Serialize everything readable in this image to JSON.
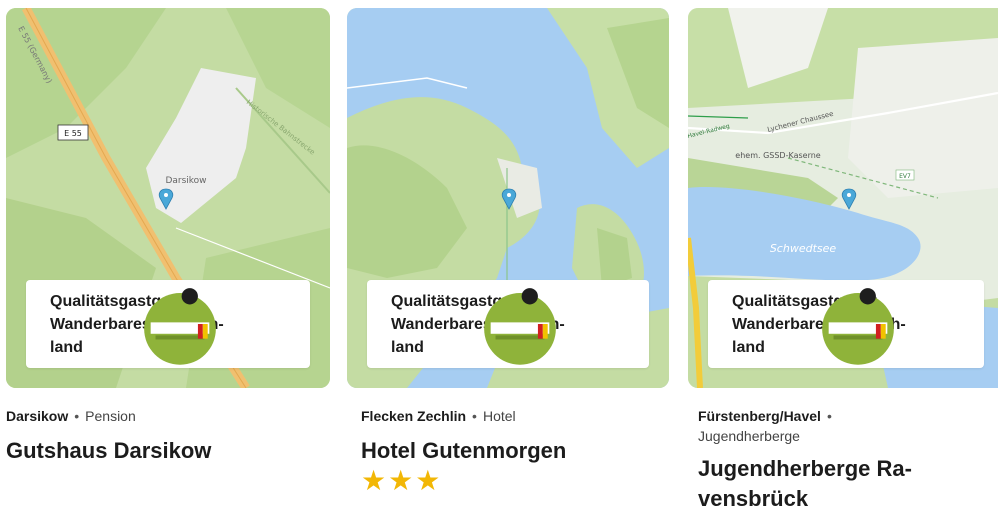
{
  "cards": [
    {
      "location": "Darsikow",
      "type": "Pension",
      "title": "Gutshaus Darsikow",
      "badge_text": "Qualitätsgastgeber Wanderbares Deutsch-land",
      "map_labels": {
        "road": "E 55",
        "place": "Darsikow",
        "road_side": "E 55 (Germany)",
        "path": "Historische Bahnstrecke"
      },
      "stars": ""
    },
    {
      "location": "Flecken Zechlin",
      "type": "Hotel",
      "title": "Hotel Gutenmorgen",
      "badge_text": "Qualitätsgastgeber Wanderbares Deutsch-land",
      "stars": "★★★",
      "star_rating": 3
    },
    {
      "location": "Fürstenberg/Havel",
      "type": "Jugendherberge",
      "title": "Jugendherberge Ra-vensbrück",
      "badge_text": "Qualitätsgastgeber Wanderbares Deutsch-land",
      "map_labels": {
        "lake": "Schwedtsee",
        "area": "ehem. GSSD-Kaserne",
        "road": "Lychener Chaussee",
        "route": "EV7",
        "path": "Havel-Radweg"
      },
      "stars": ""
    }
  ],
  "colors": {
    "land": "#c7dfa7",
    "forest": "#b3d38e",
    "water": "#a6cdf2",
    "highway": "#f0c070",
    "pin": "#4aa8d8",
    "star": "#f2b705",
    "logo_green": "#8fb33a"
  }
}
